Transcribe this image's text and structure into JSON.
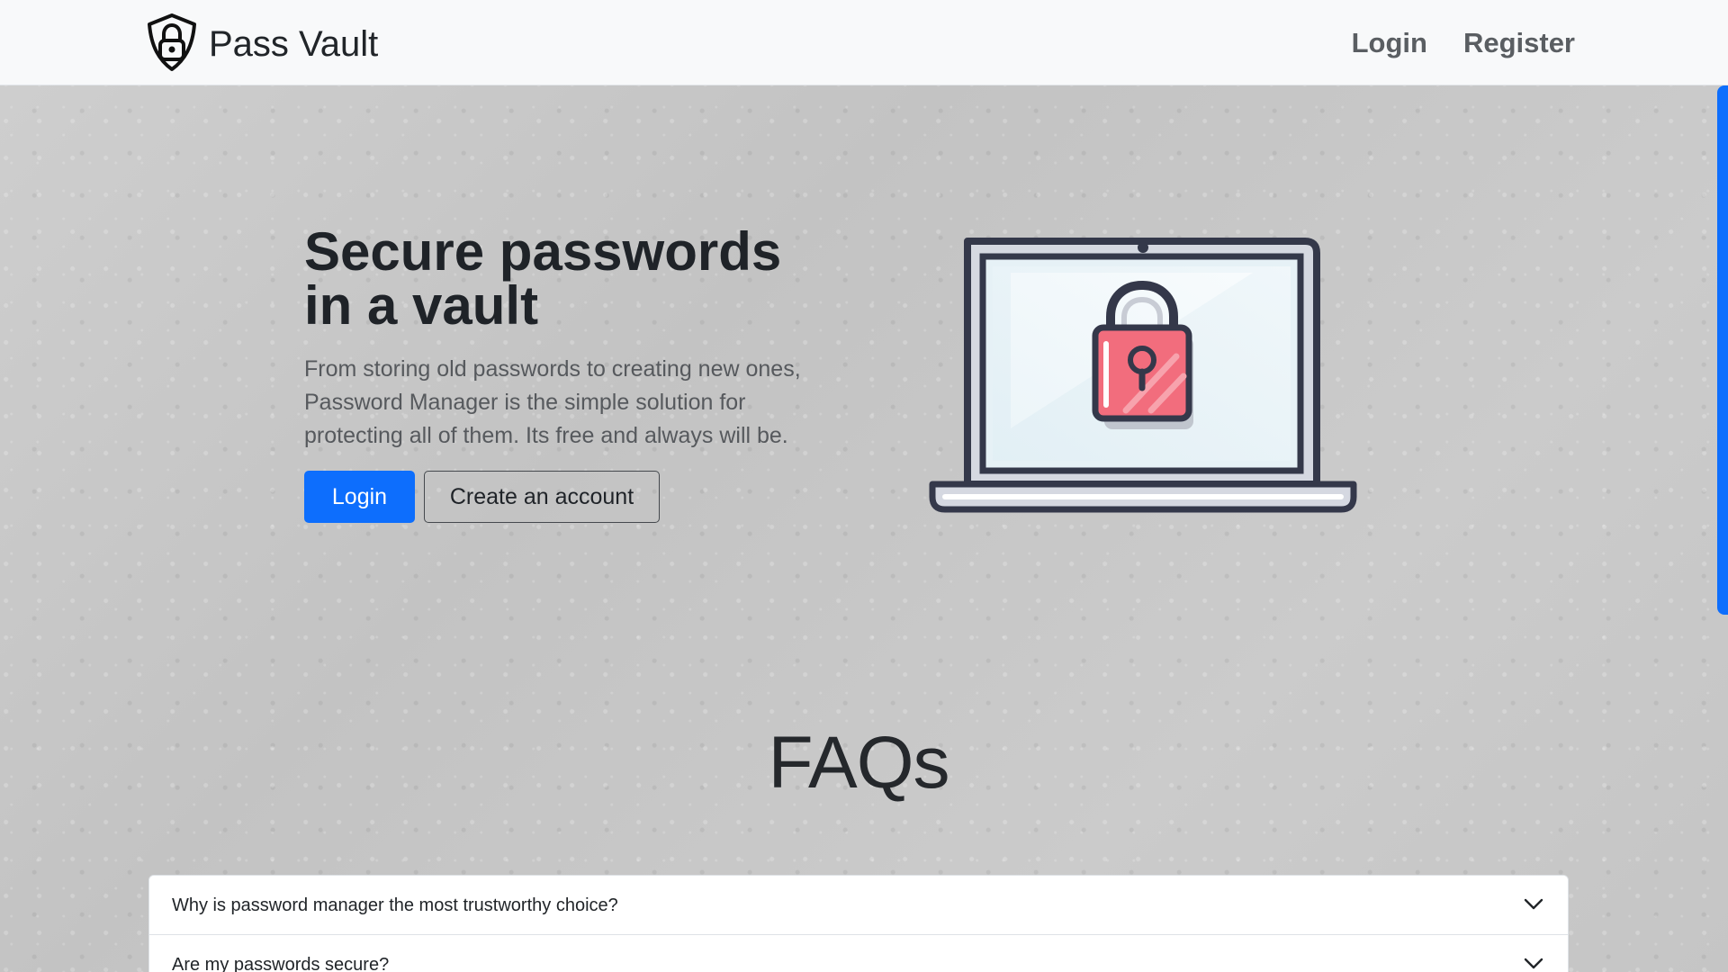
{
  "brand": {
    "name": "Pass Vault",
    "icon": "shield-lock-icon"
  },
  "nav": {
    "login": "Login",
    "register": "Register"
  },
  "hero": {
    "title": "Secure passwords in a vault",
    "lead": "From storing old passwords to creating new ones, Password Manager is the simple solution for protecting all of them. Its free and always will be.",
    "primary_button": "Login",
    "secondary_button": "Create an account",
    "illustration": "laptop-lock-icon"
  },
  "faq": {
    "title": "FAQs",
    "items": [
      {
        "question": "Why is password manager the most trustworthy choice?",
        "icon": "chevron-down-icon"
      },
      {
        "question": "Are my passwords secure?",
        "icon": "chevron-down-icon"
      }
    ]
  },
  "colors": {
    "primary": "#0d6efd",
    "navbar": "#f8f9fa",
    "background": "#c8c8c8",
    "lock": "#f26d7d",
    "text": "#212529"
  }
}
